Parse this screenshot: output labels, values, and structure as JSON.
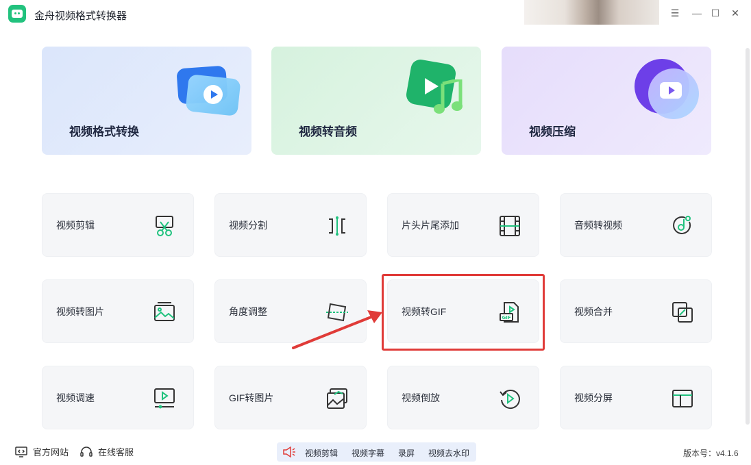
{
  "app": {
    "title": "金舟视频格式转换器"
  },
  "window_controls": {
    "menu": "☰",
    "minimize": "—",
    "maximize": "☐",
    "close": "✕"
  },
  "features": [
    {
      "label": "视频格式转换",
      "icon": "video-convert-icon",
      "color": "#2f78ee"
    },
    {
      "label": "视频转音频",
      "icon": "video-to-audio-icon",
      "color": "#1fb36a"
    },
    {
      "label": "视频压缩",
      "icon": "video-compress-icon",
      "color": "#6d3fe8"
    }
  ],
  "tools": [
    {
      "label": "视频剪辑",
      "icon": "scissors-icon"
    },
    {
      "label": "视频分割",
      "icon": "split-icon"
    },
    {
      "label": "片头片尾添加",
      "icon": "film-strip-icon"
    },
    {
      "label": "音频转视频",
      "icon": "music-disc-icon"
    },
    {
      "label": "视频转图片",
      "icon": "image-icon"
    },
    {
      "label": "角度调整",
      "icon": "rotate-frame-icon"
    },
    {
      "label": "视频转GIF",
      "icon": "gif-file-icon"
    },
    {
      "label": "视频合并",
      "icon": "merge-icon"
    },
    {
      "label": "视频调速",
      "icon": "speed-icon"
    },
    {
      "label": "GIF转图片",
      "icon": "gif-image-icon"
    },
    {
      "label": "视频倒放",
      "icon": "reverse-play-icon"
    },
    {
      "label": "视频分屏",
      "icon": "split-screen-icon"
    }
  ],
  "accent_color": "#20c27e",
  "highlight_color": "#e03b38",
  "footer": {
    "website": "官方网站",
    "service": "在线客服",
    "promo_links": [
      "视频剪辑",
      "视频字幕",
      "录屏",
      "视频去水印"
    ],
    "version": "版本号：v4.1.6"
  }
}
